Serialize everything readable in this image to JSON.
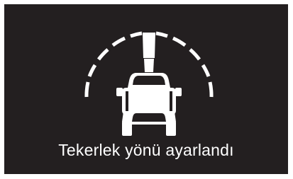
{
  "display": {
    "message": "Tekerlek yönü ayarlandı",
    "icon": "car-wheel-direction-icon",
    "colors": {
      "background": "#231f20",
      "foreground": "#ffffff"
    }
  }
}
